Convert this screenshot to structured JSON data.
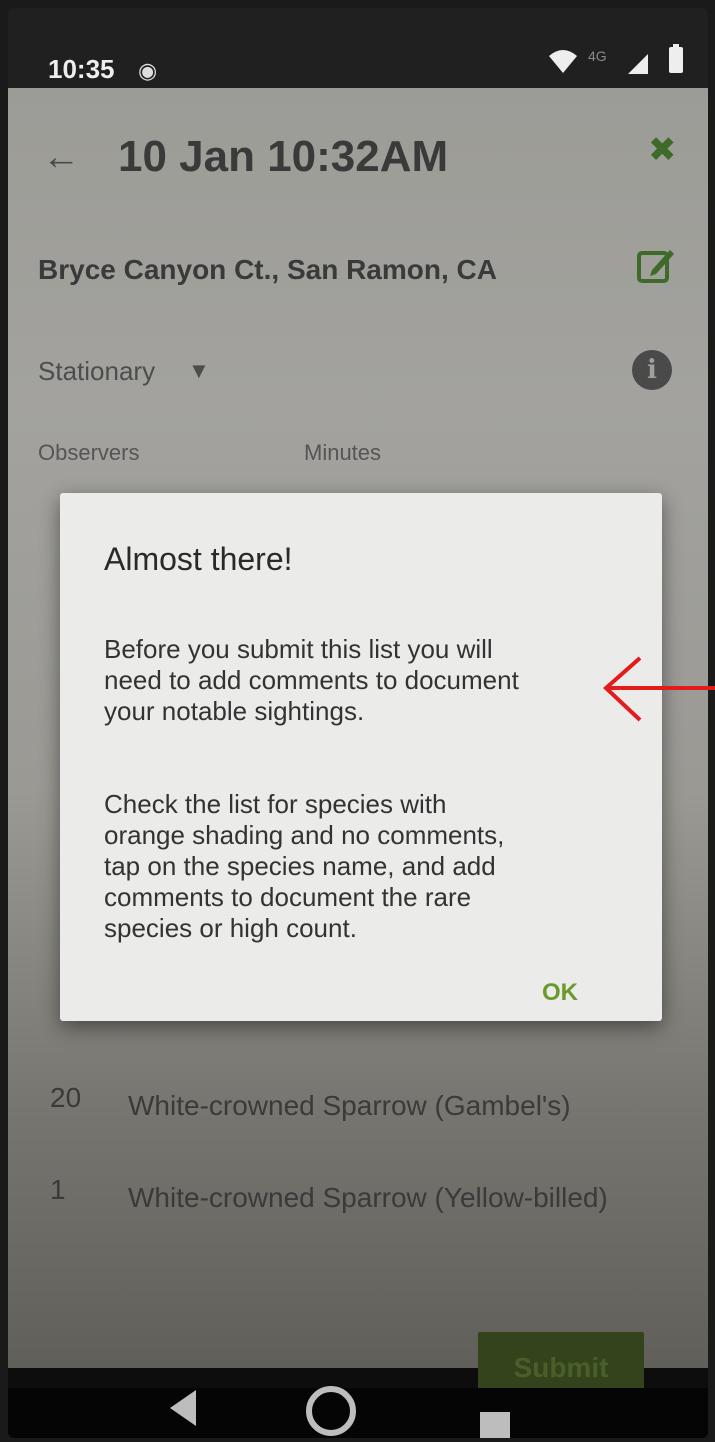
{
  "status_bar": {
    "time": "10:35",
    "network": "4G"
  },
  "header": {
    "title": "10 Jan 10:32AM"
  },
  "checklist": {
    "location": "Bryce Canyon Ct., San Ramon, CA",
    "protocol": "Stationary",
    "observers_label": "Observers",
    "minutes_label": "Minutes"
  },
  "species": [
    {
      "count": "20",
      "name": "White-crowned Sparrow (Gambel's)"
    },
    {
      "count": "1",
      "name": "White-crowned Sparrow (Yellow-billed)"
    }
  ],
  "submit_label": "Submit",
  "dialog": {
    "title": "Almost there!",
    "body_paragraph_1": "Before you submit this list you will\nneed to add comments to document\nyour notable sightings.",
    "body_paragraph_2": "Check the list for species with\norange shading and no comments,\ntap on the species name, and add\ncomments to document the rare\nspecies or high count.",
    "ok_label": "OK"
  },
  "colors": {
    "accent_green": "#6b9a2c",
    "annotation_red": "#e31b1b"
  },
  "icons": [
    "eye-icon",
    "wifi-icon",
    "signal-icon",
    "battery-icon",
    "back-arrow-icon",
    "close-icon",
    "edit-icon",
    "dropdown-icon",
    "info-icon",
    "back-nav-icon",
    "home-nav-icon",
    "recents-nav-icon",
    "annotation-arrow"
  ]
}
